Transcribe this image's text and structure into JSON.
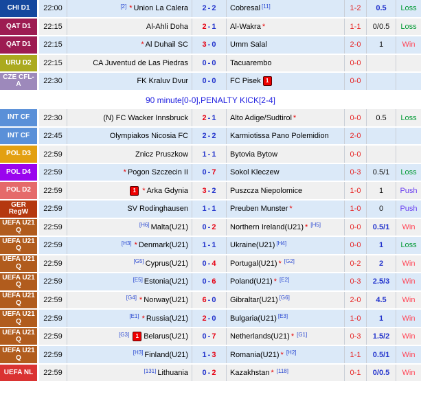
{
  "colors": {
    "row_blue": "#dbe9f8",
    "row_gray": "#f0f0f0",
    "score_red": "#e60012",
    "score_blue": "#2233cc",
    "ht_red": "#e62222",
    "win_red": "#ff4455",
    "loss_green": "#009933",
    "push_violet": "#6a3ff0",
    "notice_blue": "#2222e0"
  },
  "notice_row": {
    "text": "90 minute[0-0],PENALTY KICK[2-4]"
  },
  "rows": [
    {
      "type": "match",
      "bg": "blue",
      "league": "CHI D1",
      "league_color": "#15489e",
      "time": "22:00",
      "home": [
        {
          "t": "sup",
          "v": "[2]"
        },
        {
          "t": "star"
        },
        {
          "t": "text",
          "v": "Union La Calera"
        }
      ],
      "score": {
        "h": "2",
        "a": "2",
        "hc": "b",
        "ac": "b"
      },
      "away": [
        {
          "t": "text",
          "v": "Cobresal"
        },
        {
          "t": "sup",
          "v": "[11]"
        }
      ],
      "ht": "1-2",
      "hcp": "0.5",
      "hcp_style": "blue",
      "res": "Loss",
      "res_color": "green"
    },
    {
      "type": "match",
      "bg": "gray",
      "league": "QAT D1",
      "league_color": "#9d1c52",
      "time": "22:15",
      "home": [
        {
          "t": "text",
          "v": "Al-Ahli Doha"
        }
      ],
      "score": {
        "h": "2",
        "a": "1",
        "hc": "r",
        "ac": "b"
      },
      "away": [
        {
          "t": "text",
          "v": "Al-Wakra"
        },
        {
          "t": "star"
        }
      ],
      "ht": "1-1",
      "hcp": "0/0.5",
      "hcp_style": "black",
      "res": "Loss",
      "res_color": "green"
    },
    {
      "type": "match",
      "bg": "blue",
      "league": "QAT D1",
      "league_color": "#9d1c52",
      "time": "22:15",
      "home": [
        {
          "t": "star"
        },
        {
          "t": "text",
          "v": "Al Duhail SC"
        }
      ],
      "score": {
        "h": "3",
        "a": "0",
        "hc": "r",
        "ac": "b"
      },
      "away": [
        {
          "t": "text",
          "v": "Umm Salal"
        }
      ],
      "ht": "2-0",
      "hcp": "1",
      "hcp_style": "black",
      "res": "Win",
      "res_color": "red"
    },
    {
      "type": "match",
      "bg": "gray",
      "league": "URU D2",
      "league_color": "#abaa1f",
      "time": "22:15",
      "home": [
        {
          "t": "text",
          "v": "CA Juventud de Las Piedras"
        }
      ],
      "score": {
        "h": "0",
        "a": "0",
        "hc": "b",
        "ac": "b"
      },
      "away": [
        {
          "t": "text",
          "v": "Tacuarembo"
        }
      ],
      "ht": "0-0",
      "hcp": "",
      "hcp_style": "black",
      "res": "",
      "res_color": "green"
    },
    {
      "type": "match",
      "bg": "blue",
      "league": "CZE CFL-A",
      "league_color": "#9d89bb",
      "time": "22:30",
      "home": [
        {
          "t": "text",
          "v": "FK Kraluv Dvur"
        }
      ],
      "score": {
        "h": "0",
        "a": "0",
        "hc": "b",
        "ac": "b"
      },
      "away": [
        {
          "t": "text",
          "v": "FC Pisek"
        },
        {
          "t": "redcard",
          "v": "1"
        }
      ],
      "ht": "0-0",
      "hcp": "",
      "hcp_style": "black",
      "res": "",
      "res_color": "green"
    },
    {
      "type": "notice",
      "text": "90 minute[0-0],PENALTY KICK[2-4]"
    },
    {
      "type": "match",
      "bg": "gray",
      "league": "INT CF",
      "league_color": "#5a90d8",
      "time": "22:30",
      "home": [
        {
          "t": "text",
          "v": "(N) FC Wacker Innsbruck"
        }
      ],
      "score": {
        "h": "2",
        "a": "1",
        "hc": "r",
        "ac": "b"
      },
      "away": [
        {
          "t": "text",
          "v": "Alto Adige/Sudtirol"
        },
        {
          "t": "star"
        }
      ],
      "ht": "0-0",
      "hcp": "0.5",
      "hcp_style": "black",
      "res": "Loss",
      "res_color": "green"
    },
    {
      "type": "match",
      "bg": "blue",
      "league": "INT CF",
      "league_color": "#5a90d8",
      "time": "22:45",
      "home": [
        {
          "t": "text",
          "v": "Olympiakos Nicosia FC"
        }
      ],
      "score": {
        "h": "2",
        "a": "2",
        "hc": "b",
        "ac": "b"
      },
      "away": [
        {
          "t": "text",
          "v": "Karmiotissa Pano Polemidion"
        }
      ],
      "ht": "2-0",
      "hcp": "",
      "hcp_style": "black",
      "res": "",
      "res_color": "green"
    },
    {
      "type": "match",
      "bg": "gray",
      "league": "POL D3",
      "league_color": "#e3a011",
      "time": "22:59",
      "home": [
        {
          "t": "text",
          "v": "Znicz Pruszkow"
        }
      ],
      "score": {
        "h": "1",
        "a": "1",
        "hc": "b",
        "ac": "b"
      },
      "away": [
        {
          "t": "text",
          "v": "Bytovia Bytow"
        }
      ],
      "ht": "0-0",
      "hcp": "",
      "hcp_style": "black",
      "res": "",
      "res_color": "green"
    },
    {
      "type": "match",
      "bg": "blue",
      "league": "POL D4",
      "league_color": "#9a05ee",
      "time": "22:59",
      "home": [
        {
          "t": "star"
        },
        {
          "t": "text",
          "v": "Pogon Szczecin II"
        }
      ],
      "score": {
        "h": "0",
        "a": "7",
        "hc": "b",
        "ac": "r"
      },
      "away": [
        {
          "t": "text",
          "v": "Sokol Kleczew"
        }
      ],
      "ht": "0-3",
      "hcp": "0.5/1",
      "hcp_style": "black",
      "res": "Loss",
      "res_color": "green"
    },
    {
      "type": "match",
      "bg": "gray",
      "league": "POL D2",
      "league_color": "#e56a6a",
      "time": "22:59",
      "home": [
        {
          "t": "redcard",
          "v": "1"
        },
        {
          "t": "star"
        },
        {
          "t": "text",
          "v": "Arka Gdynia"
        }
      ],
      "score": {
        "h": "3",
        "a": "2",
        "hc": "r",
        "ac": "b"
      },
      "away": [
        {
          "t": "text",
          "v": "Puszcza Niepolomice"
        }
      ],
      "ht": "1-0",
      "hcp": "1",
      "hcp_style": "black",
      "res": "Push",
      "res_color": "violet"
    },
    {
      "type": "match",
      "bg": "blue",
      "league": "GER RegW",
      "league_color": "#b5380f",
      "time": "22:59",
      "home": [
        {
          "t": "text",
          "v": "SV Rodinghausen"
        }
      ],
      "score": {
        "h": "1",
        "a": "1",
        "hc": "b",
        "ac": "b"
      },
      "away": [
        {
          "t": "text",
          "v": "Preuben Munster"
        },
        {
          "t": "star"
        }
      ],
      "ht": "1-0",
      "hcp": "0",
      "hcp_style": "black",
      "res": "Push",
      "res_color": "violet"
    },
    {
      "type": "match",
      "bg": "gray",
      "league": "UEFA U21 Q",
      "league_color": "#b15c1d",
      "time": "22:59",
      "home": [
        {
          "t": "sup",
          "v": "[H6]"
        },
        {
          "t": "text",
          "v": "Malta(U21)"
        }
      ],
      "score": {
        "h": "0",
        "a": "2",
        "hc": "b",
        "ac": "r"
      },
      "away": [
        {
          "t": "text",
          "v": "Northern Ireland(U21)"
        },
        {
          "t": "star"
        },
        {
          "t": "sup",
          "v": "[H5]"
        }
      ],
      "ht": "0-0",
      "hcp": "0.5/1",
      "hcp_style": "blue",
      "res": "Win",
      "res_color": "red"
    },
    {
      "type": "match",
      "bg": "blue",
      "league": "UEFA U21 Q",
      "league_color": "#b15c1d",
      "time": "22:59",
      "home": [
        {
          "t": "sup",
          "v": "[H3]"
        },
        {
          "t": "star"
        },
        {
          "t": "text",
          "v": "Denmark(U21)"
        }
      ],
      "score": {
        "h": "1",
        "a": "1",
        "hc": "b",
        "ac": "b"
      },
      "away": [
        {
          "t": "text",
          "v": "Ukraine(U21)"
        },
        {
          "t": "sup",
          "v": "[H4]"
        }
      ],
      "ht": "0-0",
      "hcp": "1",
      "hcp_style": "blue",
      "res": "Loss",
      "res_color": "green"
    },
    {
      "type": "match",
      "bg": "gray",
      "league": "UEFA U21 Q",
      "league_color": "#b15c1d",
      "time": "22:59",
      "home": [
        {
          "t": "sup",
          "v": "[G5]"
        },
        {
          "t": "text",
          "v": "Cyprus(U21)"
        }
      ],
      "score": {
        "h": "0",
        "a": "4",
        "hc": "b",
        "ac": "r"
      },
      "away": [
        {
          "t": "text",
          "v": "Portugal(U21)"
        },
        {
          "t": "star"
        },
        {
          "t": "sup",
          "v": "[G2]"
        }
      ],
      "ht": "0-2",
      "hcp": "2",
      "hcp_style": "blue",
      "res": "Win",
      "res_color": "red"
    },
    {
      "type": "match",
      "bg": "blue",
      "league": "UEFA U21 Q",
      "league_color": "#b15c1d",
      "time": "22:59",
      "home": [
        {
          "t": "sup",
          "v": "[E5]"
        },
        {
          "t": "text",
          "v": "Estonia(U21)"
        }
      ],
      "score": {
        "h": "0",
        "a": "6",
        "hc": "b",
        "ac": "r"
      },
      "away": [
        {
          "t": "text",
          "v": "Poland(U21)"
        },
        {
          "t": "star"
        },
        {
          "t": "sup",
          "v": "[E2]"
        }
      ],
      "ht": "0-3",
      "hcp": "2.5/3",
      "hcp_style": "blue",
      "res": "Win",
      "res_color": "red"
    },
    {
      "type": "match",
      "bg": "gray",
      "league": "UEFA U21 Q",
      "league_color": "#b15c1d",
      "time": "22:59",
      "home": [
        {
          "t": "sup",
          "v": "[G4]"
        },
        {
          "t": "star"
        },
        {
          "t": "text",
          "v": "Norway(U21)"
        }
      ],
      "score": {
        "h": "6",
        "a": "0",
        "hc": "r",
        "ac": "b"
      },
      "away": [
        {
          "t": "text",
          "v": "Gibraltar(U21)"
        },
        {
          "t": "sup",
          "v": "[G6]"
        }
      ],
      "ht": "2-0",
      "hcp": "4.5",
      "hcp_style": "blue",
      "res": "Win",
      "res_color": "red"
    },
    {
      "type": "match",
      "bg": "blue",
      "league": "UEFA U21 Q",
      "league_color": "#b15c1d",
      "time": "22:59",
      "home": [
        {
          "t": "sup",
          "v": "[E1]"
        },
        {
          "t": "star"
        },
        {
          "t": "text",
          "v": "Russia(U21)"
        }
      ],
      "score": {
        "h": "2",
        "a": "0",
        "hc": "r",
        "ac": "b"
      },
      "away": [
        {
          "t": "text",
          "v": "Bulgaria(U21)"
        },
        {
          "t": "sup",
          "v": "[E3]"
        }
      ],
      "ht": "1-0",
      "hcp": "1",
      "hcp_style": "blue",
      "res": "Win",
      "res_color": "red"
    },
    {
      "type": "match",
      "bg": "gray",
      "league": "UEFA U21 Q",
      "league_color": "#b15c1d",
      "time": "22:59",
      "home": [
        {
          "t": "sup",
          "v": "[G3]"
        },
        {
          "t": "redcard",
          "v": "1"
        },
        {
          "t": "text",
          "v": "Belarus(U21)"
        }
      ],
      "score": {
        "h": "0",
        "a": "7",
        "hc": "b",
        "ac": "r"
      },
      "away": [
        {
          "t": "text",
          "v": "Netherlands(U21)"
        },
        {
          "t": "star"
        },
        {
          "t": "sup",
          "v": "[G1]"
        }
      ],
      "ht": "0-3",
      "hcp": "1.5/2",
      "hcp_style": "blue",
      "res": "Win",
      "res_color": "red"
    },
    {
      "type": "match",
      "bg": "blue",
      "league": "UEFA U21 Q",
      "league_color": "#b15c1d",
      "time": "22:59",
      "home": [
        {
          "t": "sup",
          "v": "[H3]"
        },
        {
          "t": "text",
          "v": "Finland(U21)"
        }
      ],
      "score": {
        "h": "1",
        "a": "3",
        "hc": "b",
        "ac": "r"
      },
      "away": [
        {
          "t": "text",
          "v": "Romania(U21)"
        },
        {
          "t": "star"
        },
        {
          "t": "sup",
          "v": "[H2]"
        }
      ],
      "ht": "1-1",
      "hcp": "0.5/1",
      "hcp_style": "blue",
      "res": "Win",
      "res_color": "red"
    },
    {
      "type": "match",
      "bg": "gray",
      "league": "UEFA NL",
      "league_color": "#da3332",
      "time": "22:59",
      "home": [
        {
          "t": "sup",
          "v": "[131]"
        },
        {
          "t": "text",
          "v": "Lithuania"
        }
      ],
      "score": {
        "h": "0",
        "a": "2",
        "hc": "b",
        "ac": "r"
      },
      "away": [
        {
          "t": "text",
          "v": "Kazakhstan"
        },
        {
          "t": "star"
        },
        {
          "t": "sup",
          "v": "[118]"
        }
      ],
      "ht": "0-1",
      "hcp": "0/0.5",
      "hcp_style": "blue",
      "res": "Win",
      "res_color": "red"
    },
    {
      "type": "filler"
    }
  ]
}
